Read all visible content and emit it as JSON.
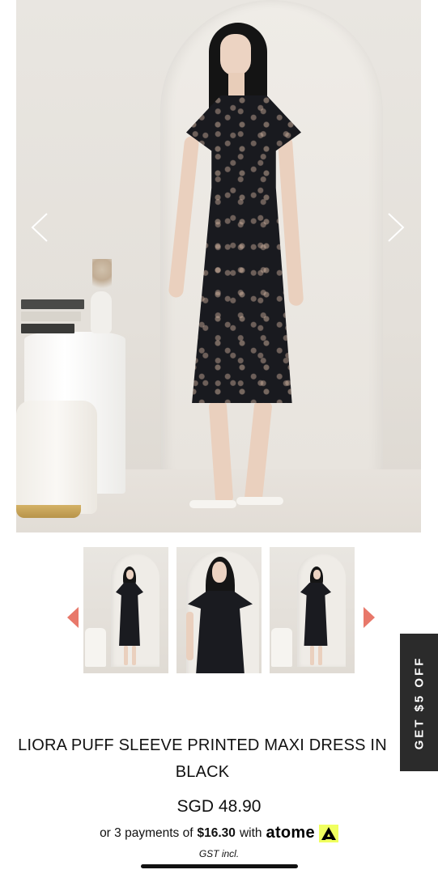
{
  "product": {
    "title": "LIORA PUFF SLEEVE PRINTED MAXI DRESS IN BLACK",
    "price": "SGD 48.90",
    "installment": {
      "prefix": "or 3 payments of",
      "amount": "$16.30",
      "with": "with",
      "provider": "atome"
    },
    "tax_note": "GST incl."
  },
  "gallery": {
    "thumbnail_count": 3,
    "accent_color": "#e8786a"
  },
  "promo": {
    "tab_label": "GET $5 OFF"
  },
  "colors": {
    "dress": "#191a1f",
    "atome_badge": "#f0ff5f",
    "promo_tab": "#2b2b2b"
  }
}
